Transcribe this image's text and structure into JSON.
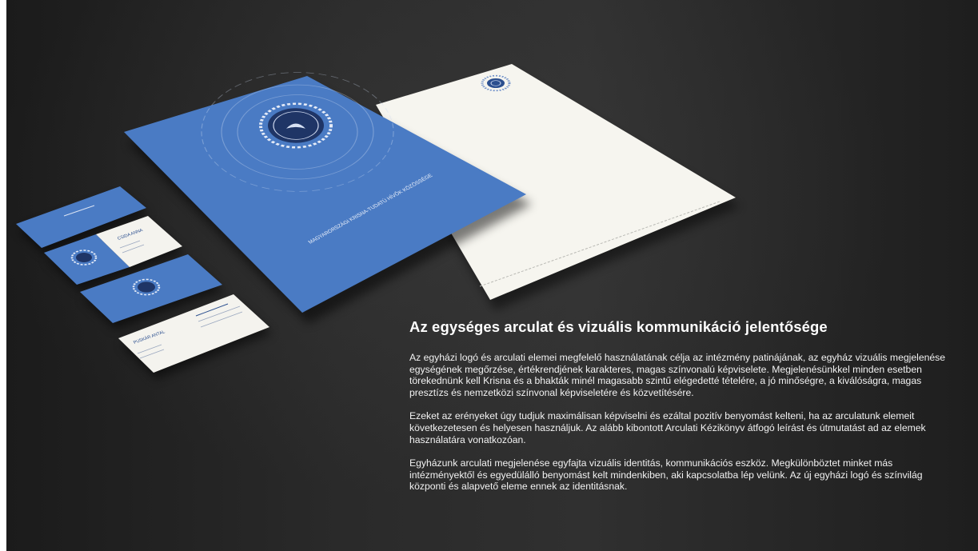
{
  "heading": "Az egységes arculat és vizuális kommunikáció jelentősége",
  "paragraphs": [
    "Az egyházi logó és arculati elemei megfelelő használatának célja az intézmény patinájának, az egyház vizuális megjelenése egységének megőrzése, értékrendjének karakteres, magas színvonalú képviselete. Megjelenésünkkel minden esetben törekednünk kell Krisna és a bhakták minél magasabb szintű elégedetté tételére, a jó minőségre, a kiválóságra, magas presztízs és nemzetközi színvonal képviseletére és közvetítésére.",
    "Ezeket az erényeket úgy tudjuk maximálisan képviselni és ezáltal pozitív benyomást kelteni, ha az arculatunk elemeit következetesen és helyesen használjuk. Az alább kibontott Arculati Kézikönyv átfogó leírást és útmutatást ad az elemek használatára vonatkozóan.",
    "Egyházunk arculati megjelenése egyfajta vizuális identitás, kommunikációs eszköz. Megkülönböztet minket más intézményektől és egyedülálló benyomást kelt mindenkiben, aki kapcsolatba lép velünk. Az új egyházi logó és színvilág  központi és alapvető eleme ennek az identitásnak."
  ],
  "mockup": {
    "cover_title": "MAGYARORSZÁGI KRISNA-TUDATÚ HÍVŐK KÖZÖSSÉGE",
    "card_name_1": "CSIDA ANNA",
    "card_name_2": "PUSKÁR ANTAL"
  },
  "colors": {
    "brand_blue": "#4a7bc4",
    "navy": "#1f3566",
    "paper": "#f6f5ef",
    "background": "#2a2a2a"
  }
}
